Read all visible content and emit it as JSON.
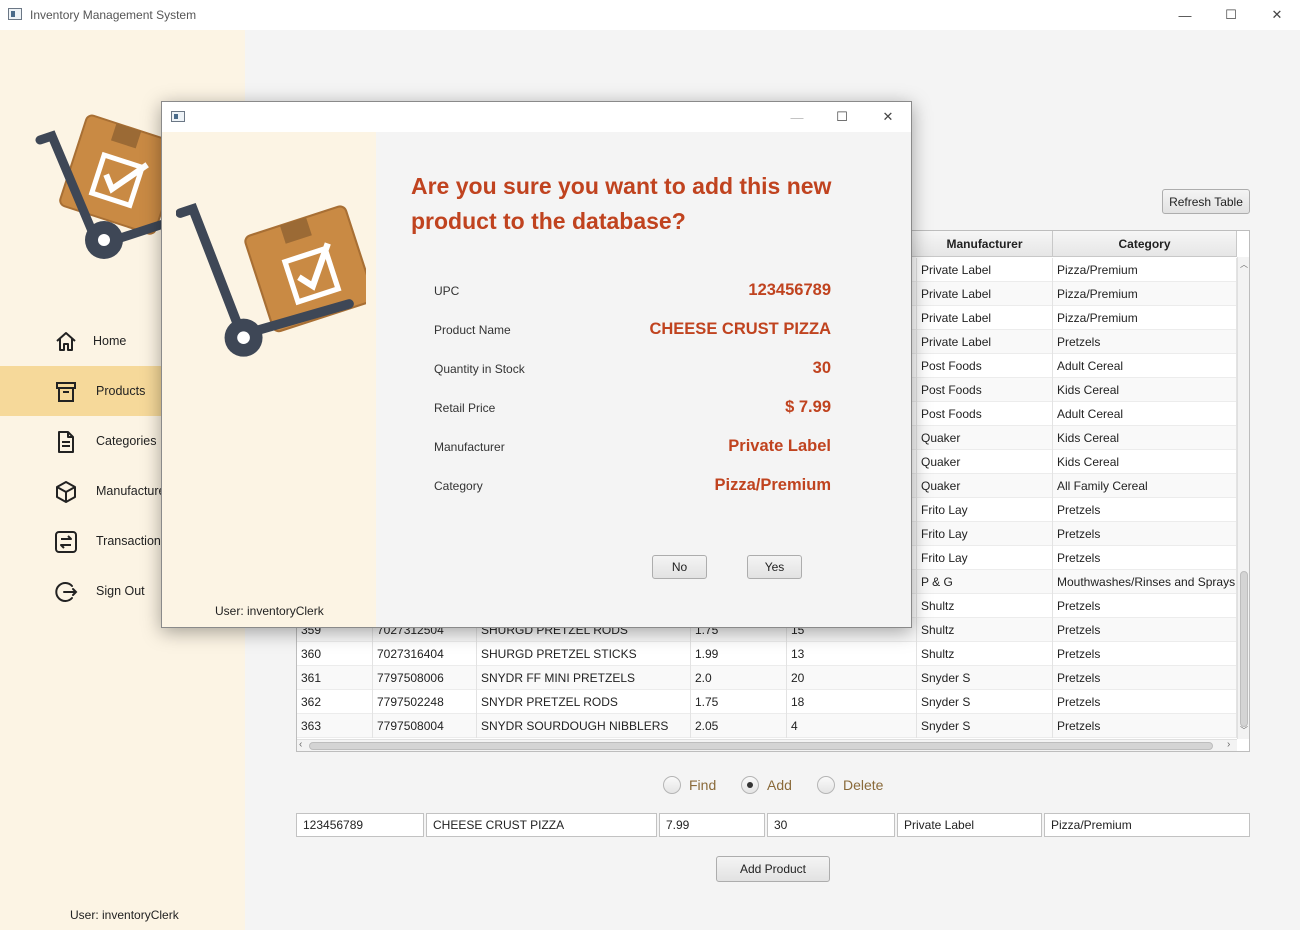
{
  "window": {
    "title": "Inventory Management System",
    "minimize": "—",
    "maximize": "☐",
    "close": "✕"
  },
  "sidebar": {
    "items": [
      {
        "label": "Home",
        "icon": "home-icon"
      },
      {
        "label": "Products",
        "icon": "archive-box-icon",
        "active": true
      },
      {
        "label": "Categories",
        "icon": "document-icon"
      },
      {
        "label": "Manufacture",
        "icon": "cube-icon"
      },
      {
        "label": "Transactions",
        "icon": "swap-icon"
      },
      {
        "label": "Sign Out",
        "icon": "sign-out-icon"
      }
    ],
    "user": "User: inventoryClerk"
  },
  "main": {
    "refresh_label": "Refresh Table",
    "table": {
      "columns": [
        "Manufacturer",
        "Category"
      ],
      "rows": [
        {
          "id": "",
          "upc": "",
          "name": "",
          "price": "",
          "qty": "",
          "manufacturer": "Private Label",
          "category": "Pizza/Premium"
        },
        {
          "id": "",
          "upc": "",
          "name": "",
          "price": "",
          "qty": "",
          "manufacturer": "Private Label",
          "category": "Pizza/Premium"
        },
        {
          "id": "",
          "upc": "",
          "name": "",
          "price": "",
          "qty": "",
          "manufacturer": "Private Label",
          "category": "Pizza/Premium"
        },
        {
          "id": "",
          "upc": "",
          "name": "",
          "price": "",
          "qty": "",
          "manufacturer": "Private Label",
          "category": "Pretzels"
        },
        {
          "id": "",
          "upc": "",
          "name": "",
          "price": "",
          "qty": "",
          "manufacturer": "Post Foods",
          "category": "Adult Cereal"
        },
        {
          "id": "",
          "upc": "",
          "name": "",
          "price": "",
          "qty": "",
          "manufacturer": "Post Foods",
          "category": "Kids Cereal"
        },
        {
          "id": "",
          "upc": "",
          "name": "",
          "price": "",
          "qty": "",
          "manufacturer": "Post Foods",
          "category": "Adult Cereal"
        },
        {
          "id": "",
          "upc": "",
          "name": "",
          "price": "",
          "qty": "",
          "manufacturer": "Quaker",
          "category": "Kids Cereal"
        },
        {
          "id": "",
          "upc": "",
          "name": "",
          "price": "",
          "qty": "",
          "manufacturer": "Quaker",
          "category": "Kids Cereal"
        },
        {
          "id": "",
          "upc": "",
          "name": "",
          "price": "",
          "qty": "",
          "manufacturer": "Quaker",
          "category": "All Family Cereal"
        },
        {
          "id": "",
          "upc": "",
          "name": "",
          "price": "",
          "qty": "",
          "manufacturer": "Frito Lay",
          "category": "Pretzels"
        },
        {
          "id": "",
          "upc": "",
          "name": "",
          "price": "",
          "qty": "",
          "manufacturer": "Frito Lay",
          "category": "Pretzels"
        },
        {
          "id": "",
          "upc": "",
          "name": "",
          "price": "",
          "qty": "",
          "manufacturer": "Frito Lay",
          "category": "Pretzels"
        },
        {
          "id": "",
          "upc": "",
          "name": "",
          "price": "",
          "qty": "",
          "manufacturer": "P & G",
          "category": "Mouthwashes/Rinses and Sprays"
        },
        {
          "id": "",
          "upc": "",
          "name": "",
          "price": "",
          "qty": "",
          "manufacturer": "Shultz",
          "category": "Pretzels"
        },
        {
          "id": "359",
          "upc": "7027312504",
          "name": "SHURGD PRETZEL RODS",
          "price": "1.75",
          "qty": "15",
          "manufacturer": "Shultz",
          "category": "Pretzels"
        },
        {
          "id": "360",
          "upc": "7027316404",
          "name": "SHURGD PRETZEL STICKS",
          "price": "1.99",
          "qty": "13",
          "manufacturer": "Shultz",
          "category": "Pretzels"
        },
        {
          "id": "361",
          "upc": "7797508006",
          "name": "SNYDR FF MINI PRETZELS",
          "price": "2.0",
          "qty": "20",
          "manufacturer": "Snyder S",
          "category": "Pretzels"
        },
        {
          "id": "362",
          "upc": "7797502248",
          "name": "SNYDR PRETZEL RODS",
          "price": "1.75",
          "qty": "18",
          "manufacturer": "Snyder S",
          "category": "Pretzels"
        },
        {
          "id": "363",
          "upc": "7797508004",
          "name": "SNYDR SOURDOUGH NIBBLERS",
          "price": "2.05",
          "qty": "4",
          "manufacturer": "Snyder S",
          "category": "Pretzels"
        }
      ]
    },
    "modes": [
      {
        "label": "Find",
        "checked": false
      },
      {
        "label": "Add",
        "checked": true
      },
      {
        "label": "Delete",
        "checked": false
      }
    ],
    "form": {
      "upc": "123456789",
      "name": "CHEESE CRUST PIZZA",
      "price": "7.99",
      "qty": "30",
      "manufacturer": "Private Label",
      "category": "Pizza/Premium"
    },
    "add_label": "Add Product"
  },
  "dialog": {
    "question": "Are you sure you want to add this new product to the database?",
    "fields": [
      {
        "label": "UPC",
        "value": "123456789"
      },
      {
        "label": "Product Name",
        "value": "CHEESE CRUST PIZZA"
      },
      {
        "label": "Quantity in Stock",
        "value": "30"
      },
      {
        "label": "Retail Price",
        "value": "$ 7.99"
      },
      {
        "label": "Manufacturer",
        "value": "Private Label"
      },
      {
        "label": "Category",
        "value": "Pizza/Premium"
      }
    ],
    "no_label": "No",
    "yes_label": "Yes",
    "user": "User: inventoryClerk"
  },
  "colors": {
    "accent": "#c0431f",
    "sidebar_bg": "#fcf4e4",
    "sidebar_active": "#f6d99a"
  }
}
